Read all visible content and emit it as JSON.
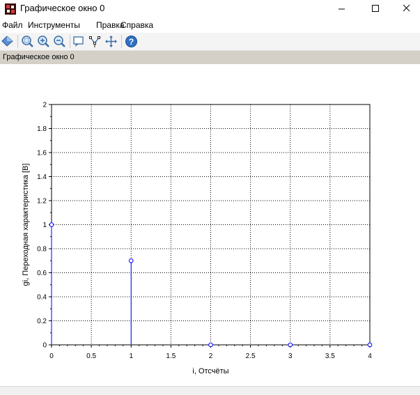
{
  "window": {
    "title": "Графическое окно 0",
    "minimize_glyph": "—",
    "maximize_glyph": "☐",
    "close_glyph": "✕"
  },
  "menu": [
    "Файл",
    "Инструменты",
    "Правка",
    "Справка"
  ],
  "toolbar_icons": [
    "rotate-icon",
    "zoom-area-icon",
    "zoom-in-icon",
    "zoom-out-icon",
    "datatip-icon",
    "curve-editor-icon",
    "pan-icon",
    "help-icon"
  ],
  "figure_label": "Графическое окно 0",
  "colors": {
    "series": "#0000ff",
    "grid": "#000000",
    "figbar": "#d4d0c8"
  },
  "chart_data": {
    "type": "stem",
    "x": [
      0,
      1,
      2,
      3,
      4
    ],
    "values": [
      1,
      0.7,
      0,
      0,
      0
    ],
    "xlabel": "i, Отсчёты",
    "ylabel": "gi, Переходная характеристика [В]",
    "xlim": [
      0,
      4
    ],
    "ylim": [
      0,
      2
    ],
    "xticks": [
      "0",
      "0.5",
      "1",
      "1.5",
      "2",
      "2.5",
      "3",
      "3.5",
      "4"
    ],
    "yticks": [
      "0",
      "0.2",
      "0.4",
      "0.6",
      "0.8",
      "1",
      "1.2",
      "1.4",
      "1.6",
      "1.8",
      "2"
    ],
    "grid": true,
    "marker": "circle"
  }
}
